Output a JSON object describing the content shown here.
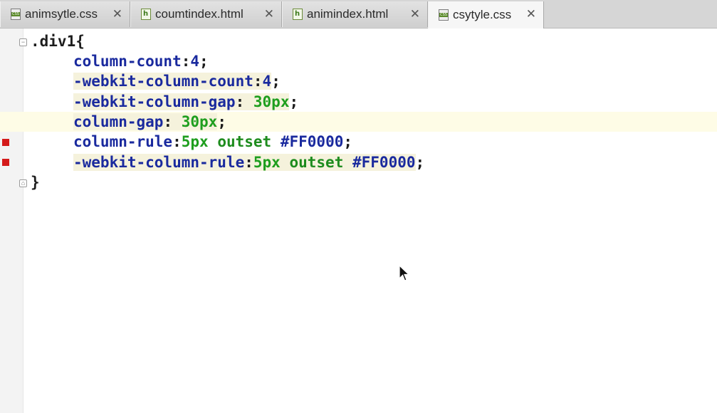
{
  "tabs": [
    {
      "label": "animsytle.css",
      "icon": "css-file-icon",
      "active": false
    },
    {
      "label": "coumtindex.html",
      "icon": "html-file-icon",
      "active": false
    },
    {
      "label": "animindex.html",
      "icon": "html-file-icon",
      "active": false
    },
    {
      "label": "csytyle.css",
      "icon": "css-file-icon",
      "active": true
    }
  ],
  "close_glyph": "✕",
  "code": {
    "line1": {
      "selector": ".div1",
      "brace": "{"
    },
    "line2": {
      "prop": "column-count",
      "sep": ":",
      "value": "4",
      "end": ";"
    },
    "line3": {
      "prop": "-webkit-column-count",
      "sep": ":",
      "value": "4",
      "end": ";"
    },
    "line4": {
      "prop": "-webkit-column-gap",
      "sep": ": ",
      "num": "30",
      "unit": "px",
      "end": ";"
    },
    "line5": {
      "prop": "column-gap",
      "sep": ": ",
      "num": "30",
      "unit": "px",
      "end": ";"
    },
    "line6": {
      "prop": "column-rule",
      "sep": ":",
      "num": "5",
      "unit": "px",
      "kw": "outset",
      "color": "#FF0000",
      "end": ";"
    },
    "line7": {
      "prop": "-webkit-column-rule",
      "sep": ":",
      "num": "5",
      "unit": "px",
      "kw": "outset",
      "color": "#FF0000",
      "end": ";"
    },
    "line8": {
      "brace": "}"
    }
  },
  "colors": {
    "property": "#1a2a9e",
    "number": "#1e9e1e",
    "error_marker": "#d41a1a",
    "current_line": "#fefce6"
  }
}
